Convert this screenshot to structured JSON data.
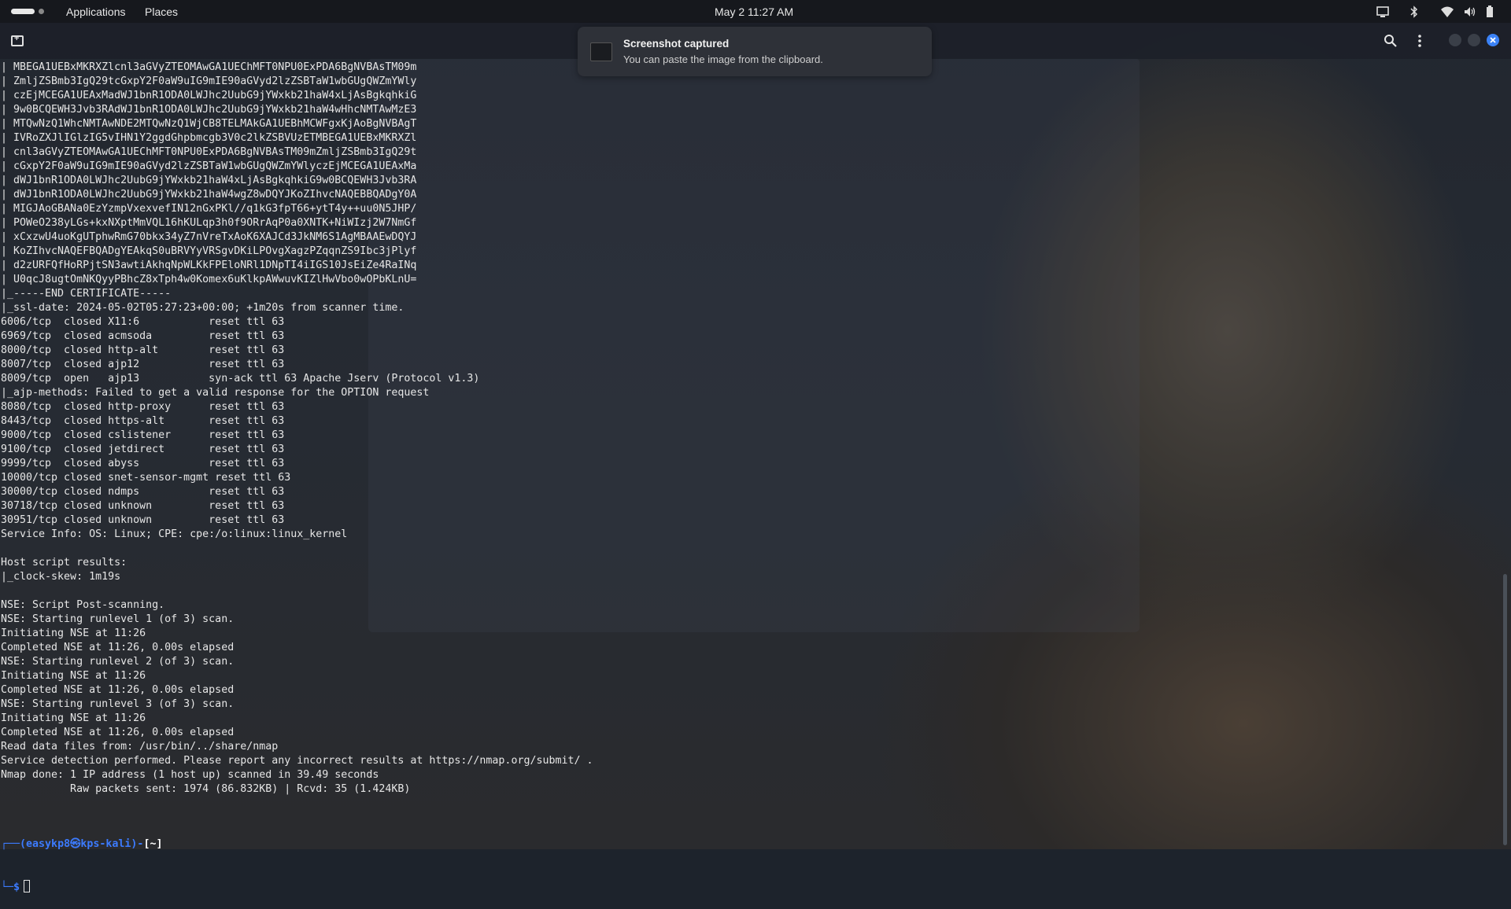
{
  "topbar": {
    "applications": "Applications",
    "places": "Places",
    "clock": "May 2  11:27 AM"
  },
  "notification": {
    "title": "Screenshot captured",
    "body": "You can paste the image from the clipboard."
  },
  "terminal": {
    "lines": [
      "| MBEGA1UEBxMKRXZlcnl3aGVyZTEOMAwGA1UEChMFT0NPU0ExPDA6BgNVBAsTM09m",
      "| ZmljZSBmb3IgQ29tcGxpY2F0aW9uIG9mIE90aGVyd2lzZSBTaW1wbGUgQWZmYWly",
      "| czEjMCEGA1UEAxMadWJ1bnR1ODA0LWJhc2UubG9jYWxkb21haW4xLjAsBgkqhkiG",
      "| 9w0BCQEWH3Jvb3RAdWJ1bnR1ODA0LWJhc2UubG9jYWxkb21haW4wHhcNMTAwMzE3",
      "| MTQwNzQ1WhcNMTAwNDE2MTQwNzQ1WjCB8TELMAkGA1UEBhMCWFgxKjAoBgNVBAgT",
      "| IVRoZXJlIGlzIG5vIHN1Y2ggdGhpbmcgb3V0c2lkZSBVUzETMBEGA1UEBxMKRXZl",
      "| cnl3aGVyZTEOMAwGA1UEChMFT0NPU0ExPDA6BgNVBAsTM09mZmljZSBmb3IgQ29t",
      "| cGxpY2F0aW9uIG9mIE90aGVyd2lzZSBTaW1wbGUgQWZmYWlyczEjMCEGA1UEAxMa",
      "| dWJ1bnR1ODA0LWJhc2UubG9jYWxkb21haW4xLjAsBgkqhkiG9w0BCQEWH3Jvb3RA",
      "| dWJ1bnR1ODA0LWJhc2UubG9jYWxkb21haW4wgZ8wDQYJKoZIhvcNAQEBBQADgY0A",
      "| MIGJAoGBANa0EzYzmpVxexvefIN12nGxPKl//q1kG3fpT66+ytT4y++uu0N5JHP/",
      "| POWeO238yLGs+kxNXptMmVQL16hKULqp3h0f9ORrAqP0a0XNTK+NiWIzj2W7NmGf",
      "| xCxzwU4uoKgUTphwRmG70bkx34yZ7nVreTxAoK6XAJCd3JkNM6S1AgMBAAEwDQYJ",
      "| KoZIhvcNAQEFBQADgYEAkqS0uBRVYyVRSgvDKiLPOvgXagzPZqqnZS9Ibc3jPlyf",
      "| d2zURFQfHoRPjtSN3awtiAkhqNpWLKkFPEloNRl1DNpTI4iIGS10JsEiZe4RaINq",
      "| U0qcJ8ugtOmNKQyyPBhcZ8xTph4w0Komex6uKlkpAWwuvKIZlHwVbo0wOPbKLnU=",
      "|_-----END CERTIFICATE-----",
      "|_ssl-date: 2024-05-02T05:27:23+00:00; +1m20s from scanner time.",
      "6006/tcp  closed X11:6           reset ttl 63",
      "6969/tcp  closed acmsoda         reset ttl 63",
      "8000/tcp  closed http-alt        reset ttl 63",
      "8007/tcp  closed ajp12           reset ttl 63",
      "8009/tcp  open   ajp13           syn-ack ttl 63 Apache Jserv (Protocol v1.3)",
      "|_ajp-methods: Failed to get a valid response for the OPTION request",
      "8080/tcp  closed http-proxy      reset ttl 63",
      "8443/tcp  closed https-alt       reset ttl 63",
      "9000/tcp  closed cslistener      reset ttl 63",
      "9100/tcp  closed jetdirect       reset ttl 63",
      "9999/tcp  closed abyss           reset ttl 63",
      "10000/tcp closed snet-sensor-mgmt reset ttl 63",
      "30000/tcp closed ndmps           reset ttl 63",
      "30718/tcp closed unknown         reset ttl 63",
      "30951/tcp closed unknown         reset ttl 63",
      "Service Info: OS: Linux; CPE: cpe:/o:linux:linux_kernel",
      "",
      "Host script results:",
      "|_clock-skew: 1m19s",
      "",
      "NSE: Script Post-scanning.",
      "NSE: Starting runlevel 1 (of 3) scan.",
      "Initiating NSE at 11:26",
      "Completed NSE at 11:26, 0.00s elapsed",
      "NSE: Starting runlevel 2 (of 3) scan.",
      "Initiating NSE at 11:26",
      "Completed NSE at 11:26, 0.00s elapsed",
      "NSE: Starting runlevel 3 (of 3) scan.",
      "Initiating NSE at 11:26",
      "Completed NSE at 11:26, 0.00s elapsed",
      "Read data files from: /usr/bin/../share/nmap",
      "Service detection performed. Please report any incorrect results at https://nmap.org/submit/ .",
      "Nmap done: 1 IP address (1 host up) scanned in 39.49 seconds",
      "           Raw packets sent: 1974 (86.832KB) | Rcvd: 35 (1.424KB)"
    ],
    "prompt": {
      "corner_top": "┌──",
      "user_host": "(easykp8㉿kps-kali)",
      "dash": "-",
      "path": "[~]",
      "corner_bottom": "└─",
      "symbol": "$"
    }
  },
  "colors": {
    "prompt_blue": "#3c7bff",
    "close_button": "#3b82f6"
  },
  "icons": [
    "new-tab-icon",
    "search-icon",
    "menu-dots-icon",
    "minimize-icon",
    "maximize-icon",
    "close-icon",
    "screen-icon",
    "bluetooth-icon",
    "wifi-icon",
    "volume-icon",
    "battery-icon"
  ]
}
